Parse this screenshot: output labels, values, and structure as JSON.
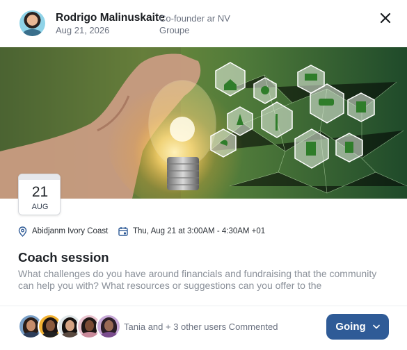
{
  "post": {
    "author_name": "Rodrigo Malinuskaite",
    "date": "Aug 21, 2026",
    "role": "Co-founder ar NV Groupe"
  },
  "event": {
    "day": "21",
    "month": "AUG",
    "location": "Abidjanm Ivory Coast",
    "datetime": "Thu, Aug 21 at 3:00AM - 4:30AM +01",
    "title": "Coach session",
    "description": "What challenges do you have around financials and fundraising that the community can help you with? What resources or suggestions can you offer to the"
  },
  "footer": {
    "comment_text": "Tania and + 3 other users Commented",
    "going_label": "Going"
  },
  "icons": {
    "close": "close-icon",
    "location": "location-pin-icon",
    "calendar": "calendar-icon",
    "chevron": "chevron-down-icon"
  },
  "colors": {
    "primary": "#2f5b97",
    "text": "#1f2328",
    "muted": "#8a9099",
    "icon_accent": "#2f5b97"
  }
}
